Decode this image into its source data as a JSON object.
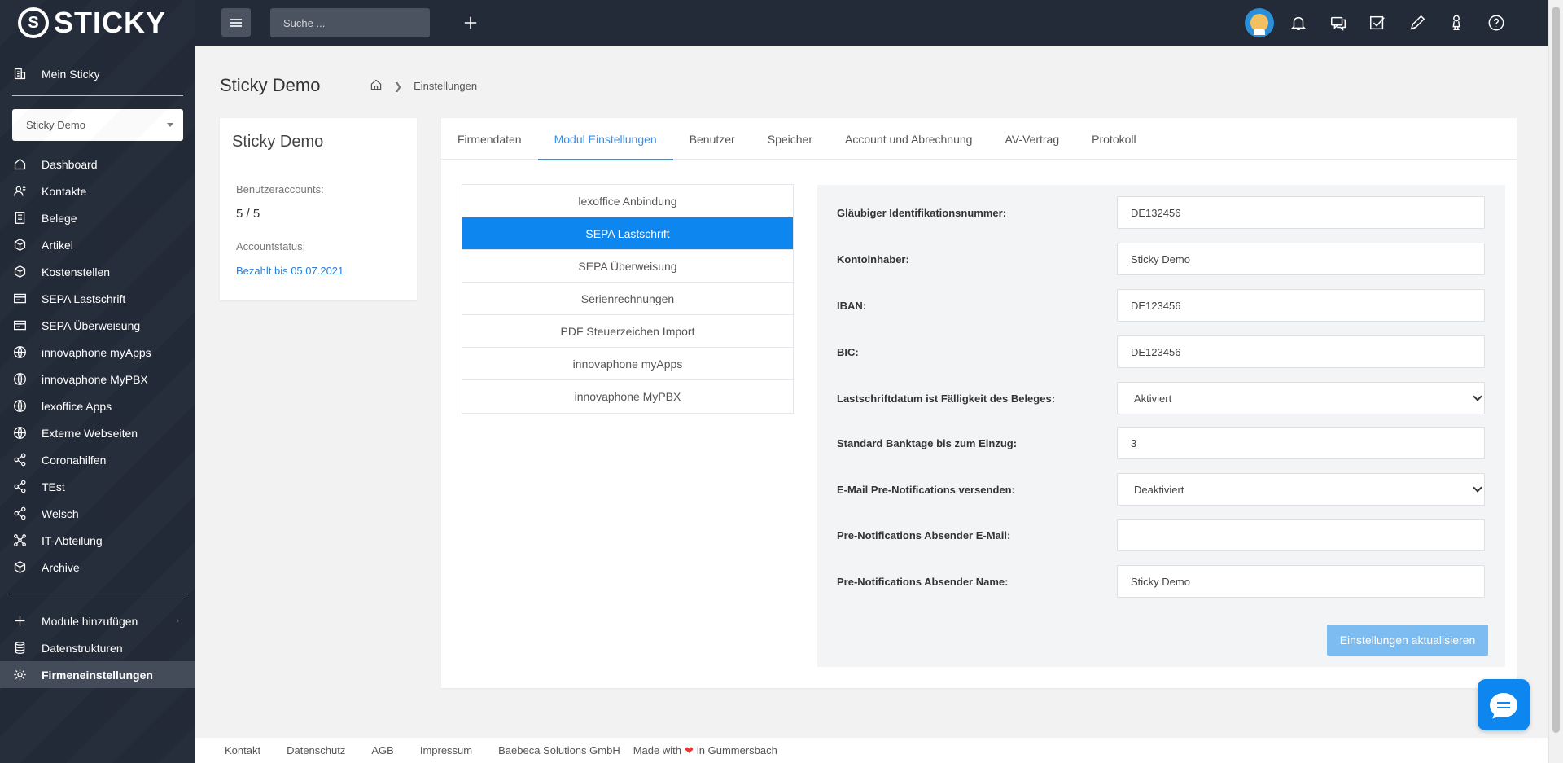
{
  "app": {
    "logo_text": "STICKY"
  },
  "sidebar": {
    "top_item": {
      "label": "Mein Sticky",
      "icon": "building-icon"
    },
    "company_select": "Sticky Demo",
    "items": [
      {
        "label": "Dashboard",
        "icon": "home-icon"
      },
      {
        "label": "Kontakte",
        "icon": "contacts-icon"
      },
      {
        "label": "Belege",
        "icon": "document-icon"
      },
      {
        "label": "Artikel",
        "icon": "box-icon"
      },
      {
        "label": "Kostenstellen",
        "icon": "box-icon"
      },
      {
        "label": "SEPA Lastschrift",
        "icon": "card-icon"
      },
      {
        "label": "SEPA Überweisung",
        "icon": "card-icon"
      },
      {
        "label": "innovaphone myApps",
        "icon": "globe-icon"
      },
      {
        "label": "innovaphone MyPBX",
        "icon": "globe-icon"
      },
      {
        "label": "lexoffice Apps",
        "icon": "globe-icon"
      },
      {
        "label": "Externe Webseiten",
        "icon": "globe-icon"
      },
      {
        "label": "Coronahilfen",
        "icon": "share-icon"
      },
      {
        "label": "TEst",
        "icon": "share-icon"
      },
      {
        "label": "Welsch",
        "icon": "share-icon"
      },
      {
        "label": "IT-Abteilung",
        "icon": "network-icon"
      },
      {
        "label": "Archive",
        "icon": "box-icon"
      }
    ],
    "bottom_items": [
      {
        "label": "Module hinzufügen",
        "icon": "plus-icon"
      },
      {
        "label": "Datenstrukturen",
        "icon": "database-icon"
      },
      {
        "label": "Firmeneinstellungen",
        "icon": "gear-icon"
      }
    ]
  },
  "topbar": {
    "search_placeholder": "Suche ..."
  },
  "header": {
    "title": "Sticky Demo",
    "breadcrumb": "Einstellungen"
  },
  "info": {
    "title": "Sticky Demo",
    "accounts_label": "Benutzeraccounts:",
    "accounts_value": "5 / 5",
    "status_label": "Accountstatus:",
    "status_value": "Bezahlt bis 05.07.2021"
  },
  "tabs": [
    {
      "label": "Firmendaten"
    },
    {
      "label": "Modul Einstellungen"
    },
    {
      "label": "Benutzer"
    },
    {
      "label": "Speicher"
    },
    {
      "label": "Account und Abrechnung"
    },
    {
      "label": "AV-Vertrag"
    },
    {
      "label": "Protokoll"
    }
  ],
  "modules": [
    "lexoffice Anbindung",
    "SEPA Lastschrift",
    "SEPA Überweisung",
    "Serienrechnungen",
    "PDF Steuerzeichen Import",
    "innovaphone myApps",
    "innovaphone MyPBX"
  ],
  "form": {
    "fields": [
      {
        "label": "Gläubiger Identifikationsnummer:",
        "value": "DE132456"
      },
      {
        "label": "Kontoinhaber:",
        "value": "Sticky Demo"
      },
      {
        "label": "IBAN:",
        "value": "DE123456"
      },
      {
        "label": "BIC:",
        "value": "DE123456"
      },
      {
        "label": "Lastschriftdatum ist Fälligkeit des Beleges:",
        "value": "Aktiviert"
      },
      {
        "label": "Standard Banktage bis zum Einzug:",
        "value": "3"
      },
      {
        "label": "E-Mail Pre-Notifications versenden:",
        "value": "Deaktiviert"
      },
      {
        "label": "Pre-Notifications Absender E-Mail:",
        "value": ""
      },
      {
        "label": "Pre-Notifications Absender Name:",
        "value": "Sticky Demo"
      }
    ],
    "submit_label": "Einstellungen aktualisieren"
  },
  "footer": {
    "links": [
      "Kontakt",
      "Datenschutz",
      "AGB",
      "Impressum",
      "Baebeca Solutions GmbH"
    ],
    "made_prefix": "Made with",
    "made_suffix": "in Gummersbach"
  },
  "colors": {
    "accent": "#0d86f0",
    "sidebar": "#242b38",
    "link": "#2a7fd4"
  }
}
